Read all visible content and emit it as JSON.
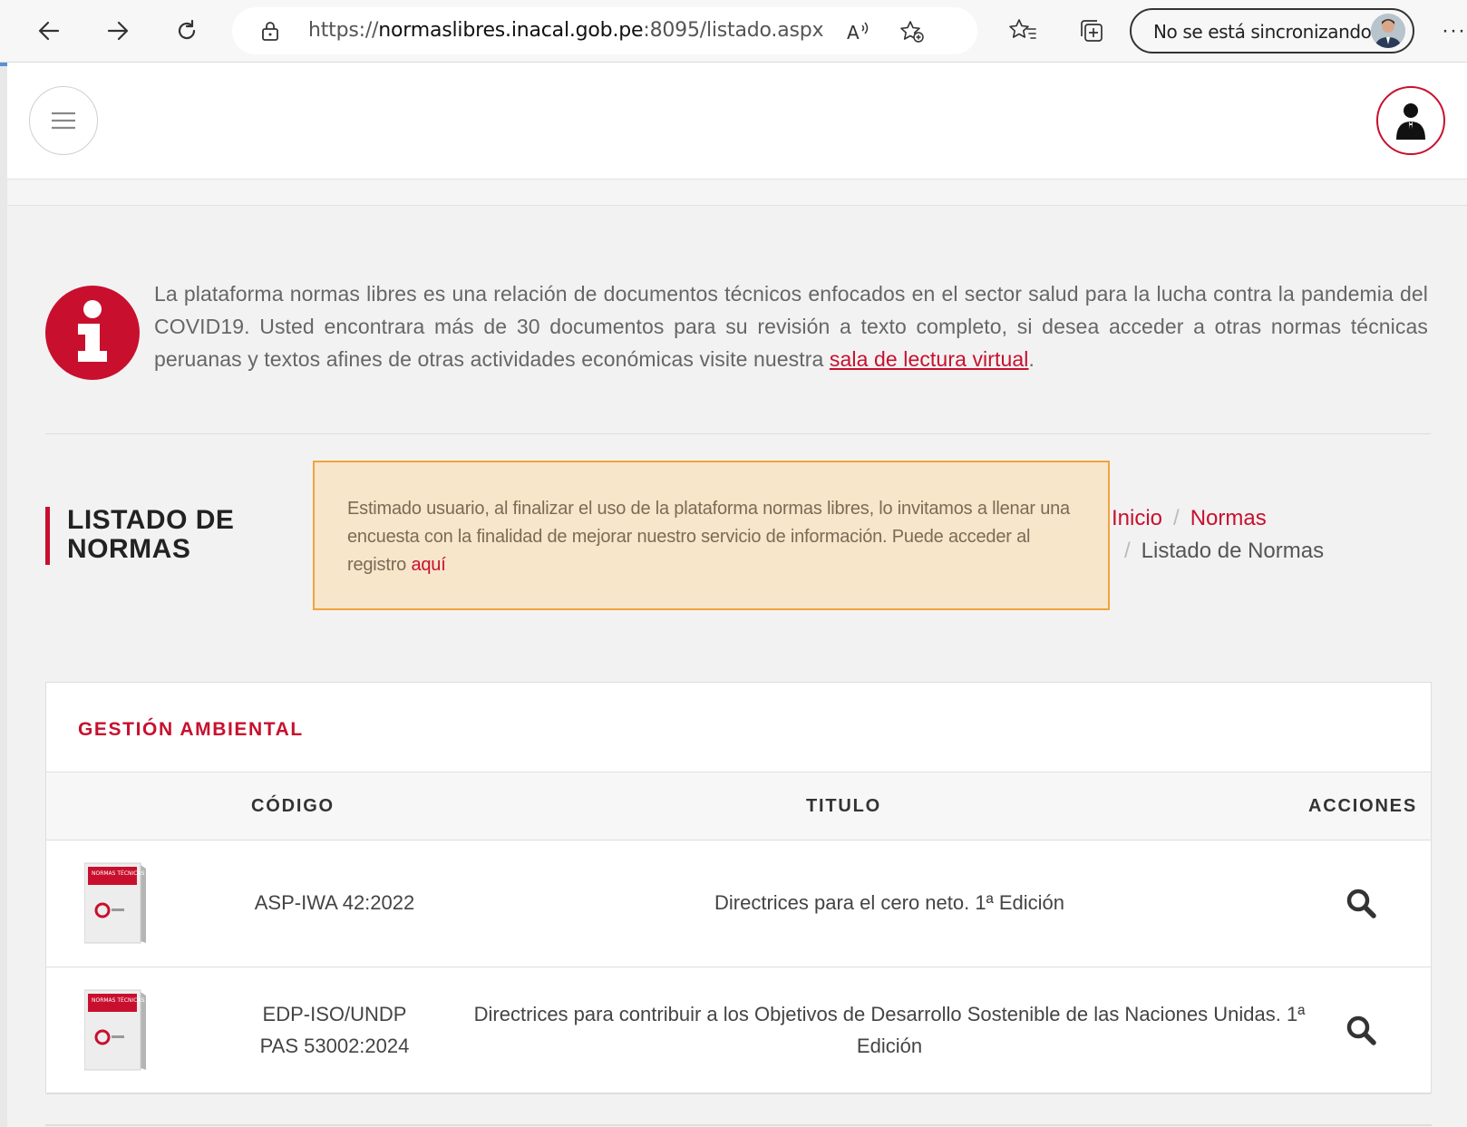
{
  "browser": {
    "url_prefix": "https://",
    "url_domain": "normaslibres.inacal.gob.pe",
    "url_rest": ":8095/listado.aspx",
    "sync_label": "No se está sincronizando",
    "more_label": "···"
  },
  "info": {
    "text": "La plataforma normas libres es una relación de documentos técnicos enfocados en el sector salud para la lucha contra la pandemia del COVID19. Usted encontrara más de 30 documentos para su revisión a texto completo, si desea acceder a otras normas técnicas peruanas y textos afines de otras actividades económicas visite nuestra ",
    "link": "sala de lectura virtual",
    "end": "."
  },
  "page_title": "LISTADO DE NORMAS",
  "notice": {
    "text": "Estimado usuario, al finalizar el uso de la plataforma normas libres, lo invitamos a llenar una encuesta con la finalidad de mejorar nuestro servicio de información. Puede acceder al registro ",
    "link": "aquí"
  },
  "breadcrumb": {
    "home": "Inicio",
    "sep": "/",
    "normas": "Normas",
    "current": "Listado de Normas"
  },
  "section": {
    "title": "GESTIÓN AMBIENTAL",
    "columns": {
      "code": "CÓDIGO",
      "title": "TITULO",
      "actions": "ACCIONES"
    },
    "rows": [
      {
        "code_line1": "ASP-IWA 42:2022",
        "code_line2": "",
        "title_line1": "Directrices para el cero neto. 1ª Edición",
        "title_line2": ""
      },
      {
        "code_line1": "EDP-ISO/UNDP",
        "code_line2": "PAS 53002:2024",
        "title_line1": "Directrices para contribuir a los Objetivos de Desarrollo Sostenible de las Naciones Unidas. 1ª",
        "title_line2": "Edición"
      }
    ],
    "book_label": "NORMAS TÉCNICAS"
  },
  "colors": {
    "accent": "#c8102e",
    "notice_bg": "#f8e6cb",
    "notice_border": "#f0a340"
  }
}
